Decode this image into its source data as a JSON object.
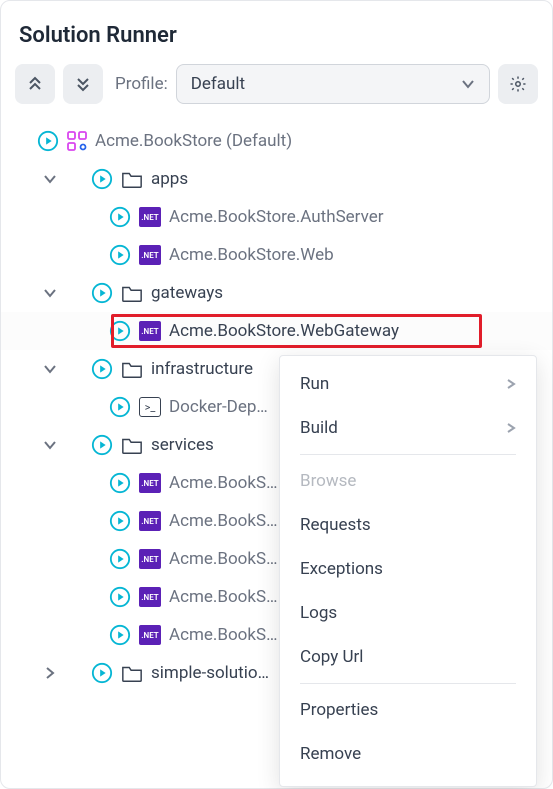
{
  "title": "Solution Runner",
  "toolbar": {
    "profile_label": "Profile:",
    "profile_value": "Default"
  },
  "tree": {
    "root_label": "Acme.BookStore (Default)",
    "apps": {
      "label": "apps",
      "items": [
        "Acme.BookStore.AuthServer",
        "Acme.BookStore.Web"
      ]
    },
    "gateways": {
      "label": "gateways",
      "items": [
        "Acme.BookStore.WebGateway"
      ]
    },
    "infrastructure": {
      "label": "infrastructure",
      "items": [
        "Docker-Dep…"
      ]
    },
    "services": {
      "label": "services",
      "items": [
        "Acme.BookS…",
        "Acme.BookS…",
        "Acme.BookS…",
        "Acme.BookS…",
        "Acme.BookS…"
      ]
    },
    "simple": {
      "label": "simple-solutio…"
    }
  },
  "net_badge_text": ".NET",
  "docker_glyph": ">_",
  "context_menu": {
    "run": "Run",
    "build": "Build",
    "browse": "Browse",
    "requests": "Requests",
    "exceptions": "Exceptions",
    "logs": "Logs",
    "copy_url": "Copy Url",
    "properties": "Properties",
    "remove": "Remove"
  }
}
